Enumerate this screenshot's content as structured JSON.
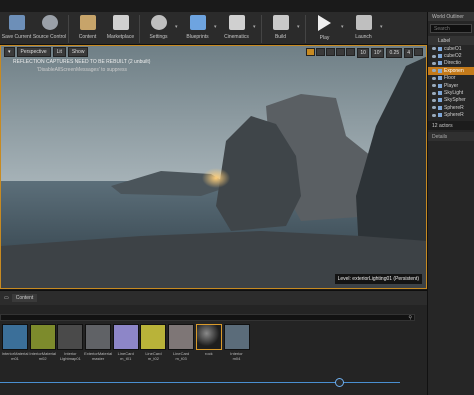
{
  "toolbar": {
    "items": [
      {
        "label": "Save Current",
        "icon": "save-icon",
        "color": "#6d8fb8"
      },
      {
        "label": "Source Control",
        "icon": "source-control-icon",
        "color": "#9aa0a8"
      },
      {
        "label": "Content",
        "icon": "content-icon",
        "color": "#c7a46a"
      },
      {
        "label": "Marketplace",
        "icon": "marketplace-icon",
        "color": "#d0d0d0"
      },
      {
        "label": "Settings",
        "icon": "settings-icon",
        "color": "#bfbfbf"
      },
      {
        "label": "Blueprints",
        "icon": "blueprints-icon",
        "color": "#6ea4e0"
      },
      {
        "label": "Cinematics",
        "icon": "cinematics-icon",
        "color": "#d0d0d0"
      },
      {
        "label": "Build",
        "icon": "build-icon",
        "color": "#c9c9c9"
      },
      {
        "label": "Play",
        "icon": "play-icon",
        "color": "#eeeeee"
      },
      {
        "label": "Launch",
        "icon": "launch-icon",
        "color": "#bfbfbf"
      }
    ]
  },
  "outliner": {
    "tab_label": "World Outliner",
    "search_placeholder": "Search",
    "column_label": "Label",
    "rows": [
      {
        "label": "cubeO1",
        "selected": false
      },
      {
        "label": "cubeO2",
        "selected": false
      },
      {
        "label": "Directio",
        "selected": false
      },
      {
        "label": "Exponen",
        "selected": true
      },
      {
        "label": "Floor",
        "selected": false
      },
      {
        "label": "Player",
        "selected": false
      },
      {
        "label": "SkyLight",
        "selected": false
      },
      {
        "label": "SkySpher",
        "selected": false
      },
      {
        "label": "SphereR",
        "selected": false
      },
      {
        "label": "SphereR",
        "selected": false
      }
    ],
    "count": "12 actors",
    "details_tab": "Details"
  },
  "viewport": {
    "perspective": "Perspective",
    "lit": "Lit",
    "show": "Show",
    "grid_snap": "10",
    "rot_snap": "10°",
    "scale_snap": "0.25",
    "camera_speed": "4",
    "warning": "REFLECTION CAPTURES NEED TO BE REBUILT (2 unbuilt)",
    "subtext": "'DisableAllScreenMessages' to suppress",
    "level_label": "Level: exteriorLighting01 (Persistent)"
  },
  "content_browser": {
    "tab_label": "Content",
    "assets": [
      {
        "name": "InteriorMaterial\nm01",
        "color": "#3b6f99",
        "selected": false
      },
      {
        "name": "InteriorMaterial\nm02",
        "color": "#7d8b2c",
        "selected": false
      },
      {
        "name": "Interior\nLightmap01",
        "color": "#4a4a4a",
        "selected": false
      },
      {
        "name": "ExteriorMaterial\nmaster",
        "color": "#606266",
        "selected": false
      },
      {
        "name": "LineCard\nm_t01",
        "color": "#8d86c8",
        "selected": false
      },
      {
        "name": "LineCard\nm_t02",
        "color": "#b9b339",
        "selected": false
      },
      {
        "name": "LineCard\nm_t03",
        "color": "#7e7676",
        "selected": false
      },
      {
        "name": "rock",
        "color": "#1e1e1e",
        "selected": true
      },
      {
        "name": "Interior\nm04",
        "color": "#5b6c7a",
        "selected": false
      }
    ]
  }
}
